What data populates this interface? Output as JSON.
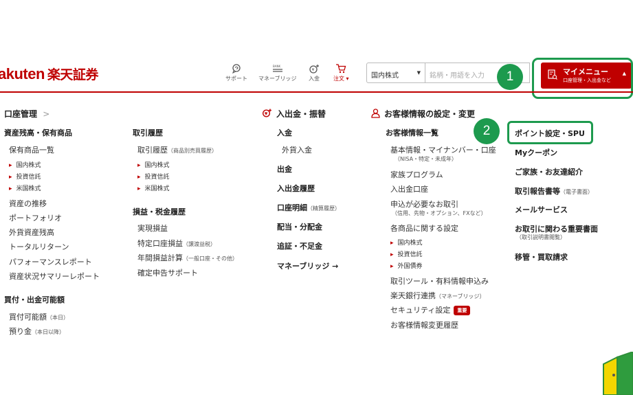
{
  "header": {
    "logo_latin": "akuten",
    "logo_jp": "楽天証券",
    "nav": {
      "support": "サポート",
      "money_bridge": "マネーブリッジ",
      "deposit": "入金",
      "order": "注文 ▾"
    },
    "search": {
      "scope": "国内株式",
      "placeholder": "銘柄・用語を入力"
    },
    "mymenu": {
      "title": "マイメニュー",
      "subtitle": "口座管理・入出金など"
    }
  },
  "badges": {
    "one": "1",
    "two": "2"
  },
  "col1": {
    "title": "口座管理",
    "title_chevron": ">",
    "group1": "資産残高・保有商品",
    "holdings": "保有商品一覧",
    "holdings_sub": [
      "国内株式",
      "投資信託",
      "米国株式"
    ],
    "links": [
      "資産の推移",
      "ポートフォリオ",
      "外貨資産残高",
      "トータルリターン",
      "パフォーマンスレポート",
      "資産状況サマリーレポート"
    ],
    "group2": "買付・出金可能額",
    "buy_power": "買付可能額",
    "buy_power_note": "（本日）",
    "deposit_amt": "預り金",
    "deposit_amt_note": "（本日以降）"
  },
  "col2": {
    "group1": "取引履歴",
    "history": "取引履歴",
    "history_note": "（商品別売買履歴）",
    "history_sub": [
      "国内株式",
      "投資信託",
      "米国株式"
    ],
    "group2": "損益・税金履歴",
    "realized": "実現損益",
    "tokutei": "特定口座損益",
    "tokutei_note": "（譲渡益税）",
    "annual": "年間損益計算",
    "annual_note": "（一般口座・その他）",
    "tax_support": "確定申告サポート"
  },
  "col3": {
    "title": "入出金・振替",
    "deposit": "入金",
    "fx_deposit": "外貨入金",
    "withdraw": "出金",
    "history": "入出金履歴",
    "statement": "口座明細",
    "statement_note": "（精算履歴）",
    "dividend": "配当・分配金",
    "margin": "追証・不足金",
    "money_bridge": "マネーブリッジ →"
  },
  "col4": {
    "title": "お客様情報の設定・変更",
    "list": "お客様情報一覧",
    "basic": "基本情報・マイナンバー・口座",
    "basic_note": "（NISA・特定・未成年）",
    "family": "家族プログラム",
    "deposit_acct": "入出金口座",
    "apply": "申込が必要なお取引",
    "apply_note": "（信用、先物・オプション、FXなど）",
    "product_settings": "各商品に関する設定",
    "product_sub": [
      "国内株式",
      "投資信託",
      "外国債券"
    ],
    "tools": "取引ツール・有料情報申込み",
    "bank": "楽天銀行連携",
    "bank_note": "（マネーブリッジ）",
    "security": "セキュリティ設定",
    "security_tag": "重要",
    "change_history": "お客様情報変更履歴"
  },
  "col5": {
    "items": [
      "ポイント設定・SPU",
      "Myクーポン",
      "ご家族・お友達紹介",
      "取引報告書等",
      "メールサービス",
      "お取引に関わる重要書面",
      "移管・買取請求"
    ],
    "report_note": "（電子書面）",
    "doc_note": "（取引説明書閲覧）"
  },
  "colors": {
    "brand_red": "#bf0000",
    "highlight_green": "#1d9a4e"
  }
}
